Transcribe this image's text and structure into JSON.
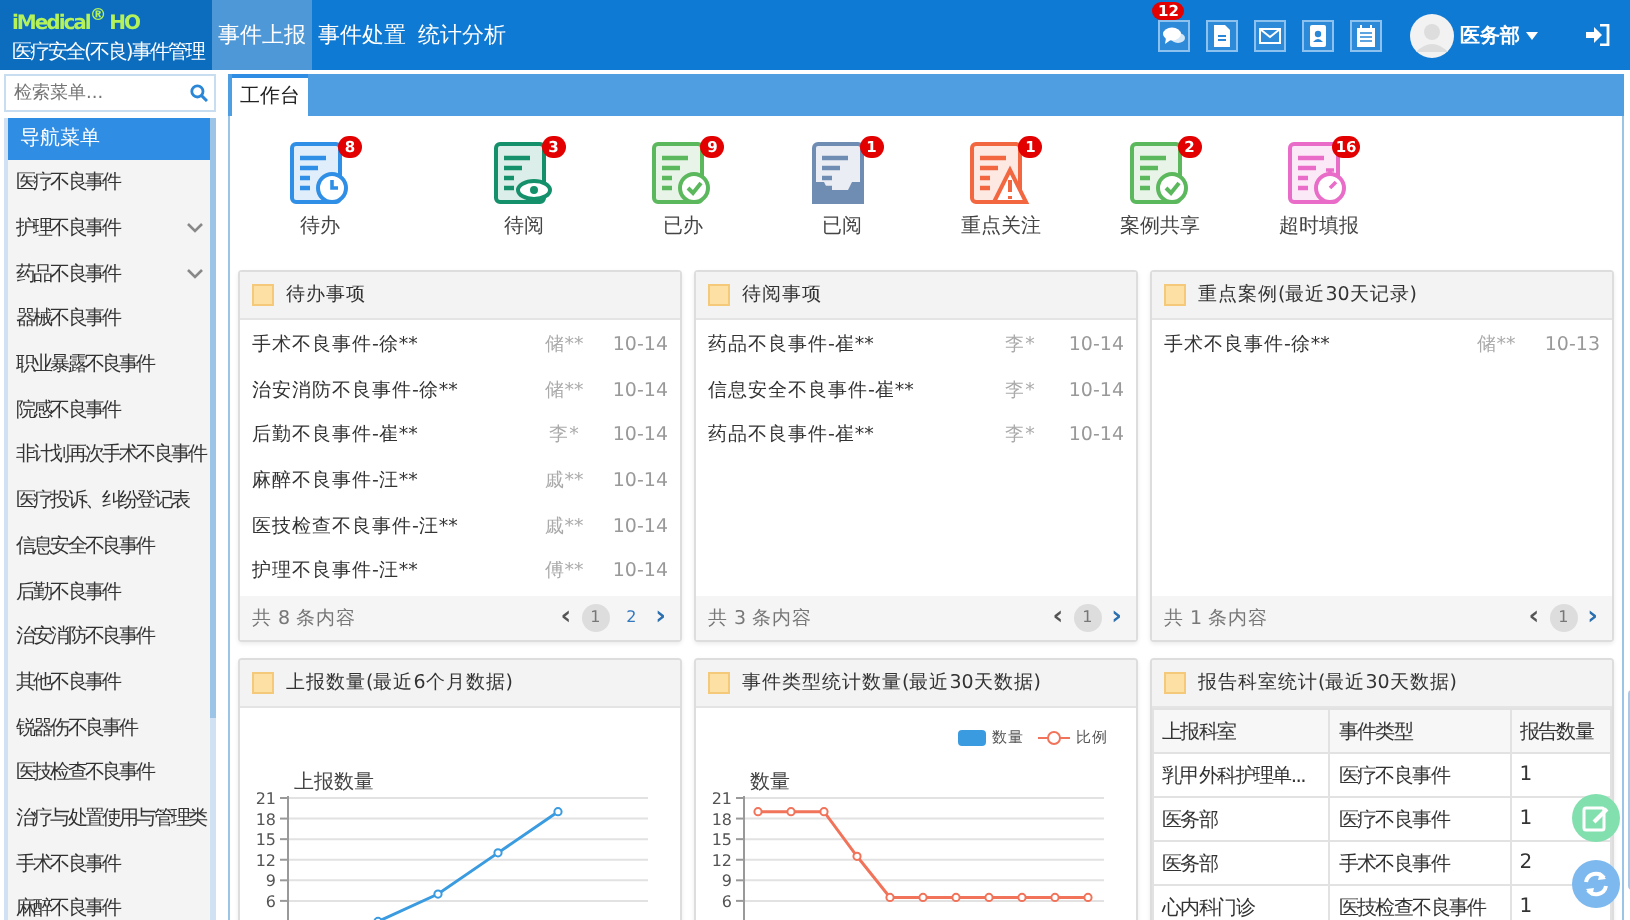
{
  "header": {
    "logo": "iMedical$^{®}$ HO",
    "subtitle": "医疗安全(不良)事件管理",
    "nav": [
      {
        "label": "事件上报",
        "selected": true
      },
      {
        "label": "事件处置",
        "selected": false
      },
      {
        "label": "统计分析",
        "selected": false
      }
    ],
    "tools": [
      {
        "kind": "chat",
        "badge": "12"
      },
      {
        "kind": "document"
      },
      {
        "kind": "mail"
      },
      {
        "kind": "contact"
      },
      {
        "kind": "calendar"
      }
    ],
    "user": "医务部"
  },
  "sidebar": {
    "search": {
      "placeholder": "检索菜单..."
    },
    "title": "导航菜单",
    "items": [
      {
        "label": "医疗不良事件",
        "expandable": false
      },
      {
        "label": "护理不良事件",
        "expandable": true
      },
      {
        "label": "药品不良事件",
        "expandable": true
      },
      {
        "label": "器械不良事件",
        "expandable": false
      },
      {
        "label": "职业暴露不良事件",
        "expandable": false
      },
      {
        "label": "院感不良事件",
        "expandable": false
      },
      {
        "label": "非计划再次手术不良事件",
        "expandable": false
      },
      {
        "label": "医疗投诉、纠纷登记表",
        "expandable": false
      },
      {
        "label": "信息安全不良事件",
        "expandable": false
      },
      {
        "label": "后勤不良事件",
        "expandable": false
      },
      {
        "label": "治安消防不良事件",
        "expandable": false
      },
      {
        "label": "其他不良事件",
        "expandable": false
      },
      {
        "label": "锐器伤不良事件",
        "expandable": false
      },
      {
        "label": "医技检查不良事件",
        "expandable": false
      },
      {
        "label": "治疗与处置使用与管理类",
        "expandable": false
      },
      {
        "label": "手术不良事件",
        "expandable": false
      },
      {
        "label": "麻醉不良事件",
        "expandable": false
      }
    ]
  },
  "tabs": [
    {
      "label": "工作台",
      "selected": true
    }
  ],
  "shortcuts": [
    {
      "label": "待办",
      "badge": "8",
      "kind": "clock",
      "color": "#2f8fe6"
    },
    {
      "label": "待阅",
      "badge": "3",
      "kind": "eye",
      "color": "#14906a"
    },
    {
      "label": "已办",
      "badge": "9",
      "kind": "check",
      "color": "#5cb85c"
    },
    {
      "label": "已阅",
      "badge": "1",
      "kind": "tray",
      "color": "#6f8db3"
    },
    {
      "label": "重点关注",
      "badge": "1",
      "kind": "warning",
      "color": "#f2673f"
    },
    {
      "label": "案例共享",
      "badge": "2",
      "kind": "check",
      "color": "#5cb85c"
    },
    {
      "label": "超时填报",
      "badge": "16",
      "kind": "timer",
      "color": "#e96cc8"
    }
  ],
  "list_panels": [
    {
      "title": "待办事项",
      "rows": [
        {
          "title": "手术不良事件-徐**",
          "person": "储**",
          "date": "10-14"
        },
        {
          "title": "治安消防不良事件-徐**",
          "person": "储**",
          "date": "10-14"
        },
        {
          "title": "后勤不良事件-崔**",
          "person": "李*",
          "date": "10-14"
        },
        {
          "title": "麻醉不良事件-汪**",
          "person": "戚**",
          "date": "10-14"
        },
        {
          "title": "医技检查不良事件-汪**",
          "person": "戚**",
          "date": "10-14"
        },
        {
          "title": "护理不良事件-汪**",
          "person": "傅**",
          "date": "10-14"
        }
      ],
      "total": "共 8 条内容",
      "prev": "‹",
      "next": "›",
      "pages": [
        {
          "label": "1",
          "selected": true
        },
        {
          "label": "2",
          "selected": false
        }
      ]
    },
    {
      "title": "待阅事项",
      "rows": [
        {
          "title": "药品不良事件-崔**",
          "person": "李*",
          "date": "10-14"
        },
        {
          "title": "信息安全不良事件-崔**",
          "person": "李*",
          "date": "10-14"
        },
        {
          "title": "药品不良事件-崔**",
          "person": "李*",
          "date": "10-14"
        }
      ],
      "total": "共 3 条内容",
      "prev": "‹",
      "next": "›",
      "pages": [
        {
          "label": "1",
          "selected": true
        }
      ]
    },
    {
      "title": "重点案例(最近30天记录)",
      "rows": [
        {
          "title": "手术不良事件-徐**",
          "person": "储**",
          "date": "10-13"
        }
      ],
      "total": "共 1 条内容",
      "prev": "‹",
      "next": "›",
      "pages": [
        {
          "label": "1",
          "selected": true
        }
      ]
    }
  ],
  "chart_panels": [
    {
      "title": "上报数量(最近6个月数据)",
      "chart_data": {
        "type": "line",
        "ylabel": "上报数量",
        "ylim": [
          3,
          21
        ],
        "yticks": [
          6,
          9,
          12,
          15,
          18,
          21
        ],
        "grid": true,
        "series": [
          {
            "color": "#3a9be0",
            "marker": "circle",
            "values": [
              null,
              3,
              7,
              13,
              19,
              null
            ]
          }
        ]
      }
    },
    {
      "title": "事件类型统计数量(最近30天数据)",
      "chart_data": {
        "type": "line",
        "ylabel": "数量",
        "ylim": [
          3,
          21
        ],
        "yticks": [
          6,
          9,
          12,
          15,
          18,
          21
        ],
        "grid": true,
        "series": [
          {
            "name": "数量",
            "color": "#3a9be0",
            "values": [
              null,
              null,
              null,
              null,
              null,
              null,
              null,
              null,
              null,
              null,
              null
            ]
          },
          {
            "name": "比例",
            "color": "#f0735a",
            "marker": "circle",
            "values": [
              19,
              19,
              19,
              12.5,
              6.5,
              6.5,
              6.5,
              6.5,
              6.5,
              6.5,
              6.5
            ]
          }
        ]
      }
    }
  ],
  "table_panel": {
    "title": "报告科室统计(最近30天数据)",
    "columns": [
      "上报科室",
      "事件类型",
      "报告数量"
    ],
    "rows": [
      [
        "乳甲外科护理单...",
        "医疗不良事件",
        "1"
      ],
      [
        "医务部",
        "医疗不良事件",
        "1"
      ],
      [
        "医务部",
        "手术不良事件",
        "2"
      ],
      [
        "心内科门诊",
        "医技检查不良事件",
        "1"
      ]
    ]
  }
}
